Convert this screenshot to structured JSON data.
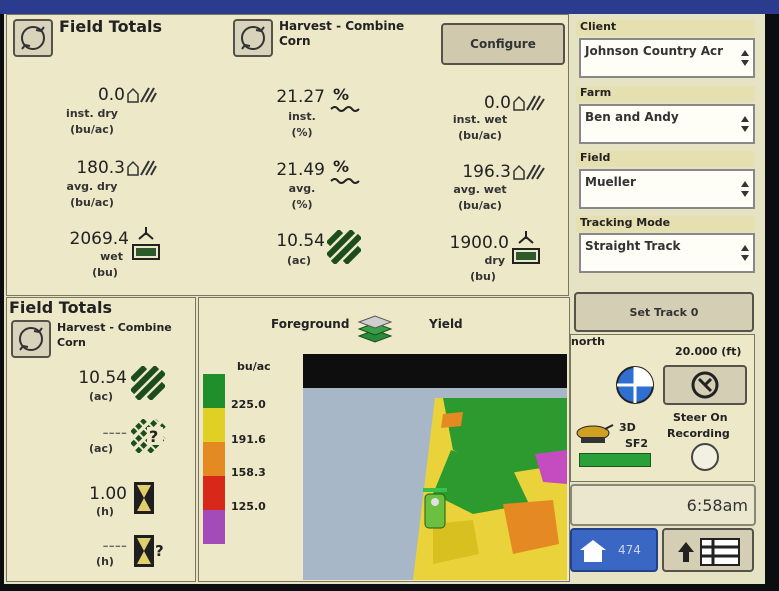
{
  "top_panel": {
    "title": "Field Totals",
    "harvest_title": "Harvest - Combine",
    "crop": "Corn",
    "configure": "Configure",
    "metrics": [
      {
        "value": "0.0",
        "label": "inst. dry",
        "unit": "(bu/ac)"
      },
      {
        "value": "21.27",
        "label": "inst.",
        "unit": "(%)"
      },
      {
        "value": "0.0",
        "label": "inst. wet",
        "unit": "(bu/ac)"
      },
      {
        "value": "180.3",
        "label": "avg. dry",
        "unit": "(bu/ac)"
      },
      {
        "value": "21.49",
        "label": "avg.",
        "unit": "(%)"
      },
      {
        "value": "196.3",
        "label": "avg. wet",
        "unit": "(bu/ac)"
      },
      {
        "value": "2069.4",
        "label": "wet",
        "unit": "(bu)"
      },
      {
        "value": "10.54",
        "label": "",
        "unit": "(ac)"
      },
      {
        "value": "1900.0",
        "label": "dry",
        "unit": "(bu)"
      }
    ]
  },
  "left_panel": {
    "title": "Field Totals",
    "harvest_title": "Harvest - Combine",
    "crop": "Corn",
    "rows": [
      {
        "value": "10.54",
        "unit": "(ac)"
      },
      {
        "value": "----",
        "unit": "(ac)"
      },
      {
        "value": "1.00",
        "unit": "(h)"
      },
      {
        "value": "----",
        "unit": "(h)"
      }
    ]
  },
  "map_panel": {
    "foreground": "Foreground",
    "layer": "Yield",
    "legend_unit": "bu/ac",
    "legend": [
      {
        "label": "225.0",
        "color": "#1f8f2c"
      },
      {
        "label": "191.6",
        "color": "#e0cf24"
      },
      {
        "label": "158.3",
        "color": "#e58a22"
      },
      {
        "label": "125.0",
        "color": "#d8281a"
      },
      {
        "label": "",
        "color": "#a34bb8"
      }
    ]
  },
  "right_panel": {
    "client_label": "Client",
    "client_value": "Johnson Country Acr",
    "farm_label": "Farm",
    "farm_value": "Ben and Andy",
    "field_label": "Field",
    "field_value": "Mueller",
    "tracking_label": "Tracking Mode",
    "tracking_value": "Straight Track",
    "set_track": "Set Track 0",
    "direction": "north",
    "width": "20.000 (ft)",
    "steer_on": "Steer On",
    "recording": "Recording",
    "gps_mode": "3D",
    "gps_sf": "SF2",
    "time": "6:58am",
    "home_number": "474"
  }
}
